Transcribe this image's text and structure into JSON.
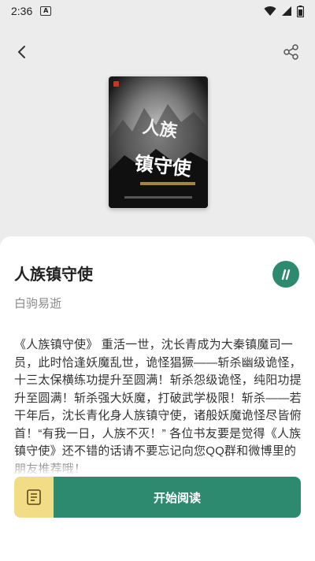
{
  "status": {
    "time": "2:36",
    "a_icon": "A"
  },
  "nav": {
    "back_icon": "chevron-left-icon",
    "share_icon": "share-icon"
  },
  "book": {
    "title": "人族镇守使",
    "author": "白驹易逝",
    "cover_title": "人族镇守使",
    "description": "《人族镇守使》 重活一世，沈长青成为大秦镇魔司一员，此时恰逢妖魔乱世，诡怪猖獗——斩杀幽级诡怪，十三太保横练功提升至圆满！斩杀怨级诡怪，纯阳功提升至圆满！斩杀强大妖魔，打破武学极限！斩杀——若干年后，沈长青化身人族镇守使，诸般妖魔诡怪尽皆俯首！“有我一日，人族不灭！” 各位书友要是觉得《人族镇守使》还不错的话请不要忘记向您QQ群和微博里的朋友推荐哦！"
  },
  "actions": {
    "read_label": "开始阅读",
    "toc_icon": "list-icon"
  },
  "colors": {
    "accent": "#2e8a6f",
    "toc_bg": "#f3dc86"
  }
}
